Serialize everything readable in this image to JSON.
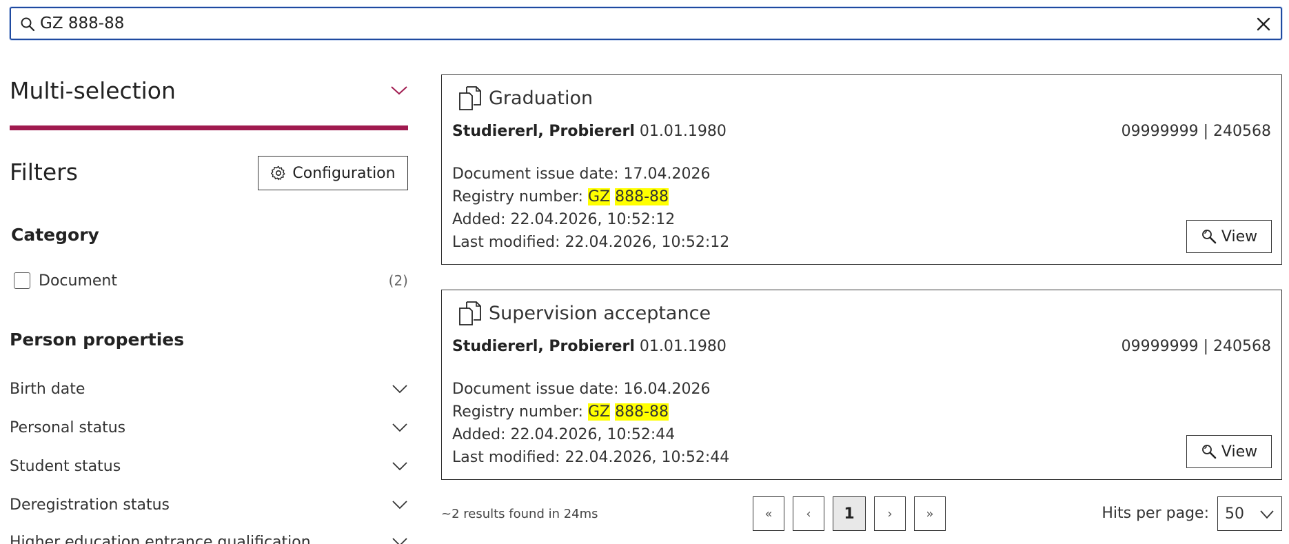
{
  "search": {
    "value": "GZ 888-88",
    "clear_icon": "close-icon"
  },
  "sidebar": {
    "multiselection_title": "Multi-selection",
    "accent_color": "#a01a4f",
    "filters_title": "Filters",
    "configuration_label": "Configuration",
    "category": {
      "title": "Category",
      "items": [
        {
          "label": "Document",
          "count": "(2)",
          "checked": false
        }
      ]
    },
    "person_properties": {
      "title": "Person properties",
      "items": [
        {
          "label": "Birth date"
        },
        {
          "label": "Personal status"
        },
        {
          "label": "Student status"
        },
        {
          "label": "Deregistration status"
        },
        {
          "label": "Higher education entrance qualification"
        }
      ]
    }
  },
  "results": [
    {
      "title": "Graduation",
      "person_name": "Studiererl, Probiererl",
      "person_date": "01.01.1980",
      "ids": "09999999 | 240568",
      "issue_date": "Document issue date: 17.04.2026",
      "registry_label": "Registry number:",
      "registry_part1": "GZ",
      "registry_part2": "888-88",
      "added": "Added: 22.04.2026, 10:52:12",
      "modified": "Last modified: 22.04.2026, 10:52:12",
      "view_label": "View"
    },
    {
      "title": "Supervision acceptance",
      "person_name": "Studiererl, Probiererl",
      "person_date": "01.01.1980",
      "ids": "09999999 | 240568",
      "issue_date": "Document issue date: 16.04.2026",
      "registry_label": "Registry number:",
      "registry_part1": "GZ",
      "registry_part2": "888-88",
      "added": "Added: 22.04.2026, 10:52:44",
      "modified": "Last modified: 22.04.2026, 10:52:44",
      "view_label": "View"
    }
  ],
  "footer": {
    "results_found": "~2 results found in 24ms",
    "pager": {
      "first": "«",
      "prev": "‹",
      "current": "1",
      "next": "›",
      "last": "»"
    },
    "hits_label": "Hits per page:",
    "hits_value": "50"
  }
}
